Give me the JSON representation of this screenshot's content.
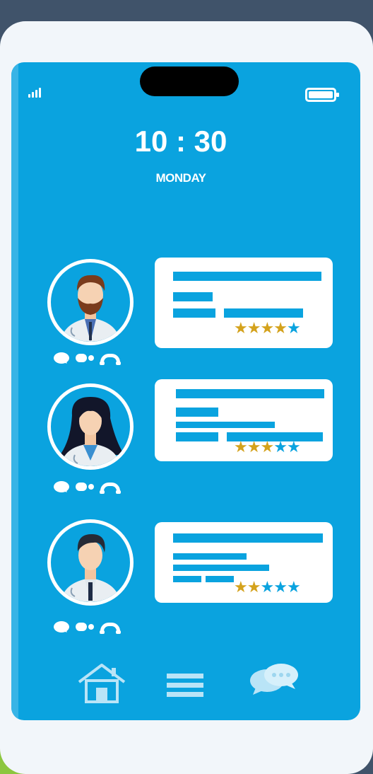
{
  "status_bar": {
    "time": "10 : 30",
    "day": "MONDAY",
    "signal_icon": "signal-icon",
    "battery_icon": "battery-icon"
  },
  "doctors": [
    {
      "name": "doctor-1",
      "rating": 4,
      "max_rating": 5,
      "star_symbol": "★",
      "actions": [
        "chat-icon",
        "video-icon",
        "phone-icon"
      ]
    },
    {
      "name": "doctor-2",
      "rating": 3,
      "max_rating": 5,
      "star_symbol": "★",
      "actions": [
        "chat-icon",
        "video-icon",
        "phone-icon"
      ]
    },
    {
      "name": "doctor-3",
      "rating": 2,
      "max_rating": 5,
      "star_symbol": "★",
      "actions": [
        "chat-icon",
        "video-icon",
        "phone-icon"
      ]
    }
  ],
  "bottom_nav": [
    "home-icon",
    "menu-icon",
    "messages-icon"
  ],
  "colors": {
    "screen": "#0aa3df",
    "star_filled": "#d4a21c",
    "star_empty": "#0aa3df",
    "background": "#40536a",
    "card": "#f2f6fa"
  }
}
